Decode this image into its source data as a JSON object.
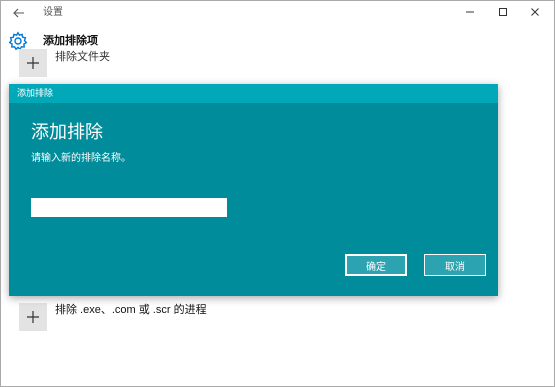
{
  "titlebar": {
    "app_title": "设置",
    "icons": {
      "back": "back-arrow-icon",
      "minimize": "minimize-icon",
      "maximize": "maximize-icon",
      "close": "close-icon"
    }
  },
  "header": {
    "title": "添加排除项",
    "icon": "gear-icon"
  },
  "exclusions": [
    {
      "label": "排除文件夹",
      "icon": "plus-icon"
    },
    {
      "label": "排除 .exe、.com 或 .scr 的进程",
      "icon": "plus-icon"
    }
  ],
  "dialog": {
    "titlebar_label": "添加排除",
    "title": "添加排除",
    "prompt": "请输入新的排除名称。",
    "input_value": "",
    "ok_label": "确定",
    "cancel_label": "取消"
  },
  "colors": {
    "dialog_body": "#008c9a",
    "dialog_titlebar": "#00a8b8",
    "accent": "#0078d7",
    "tile": "#e3e3e3"
  }
}
